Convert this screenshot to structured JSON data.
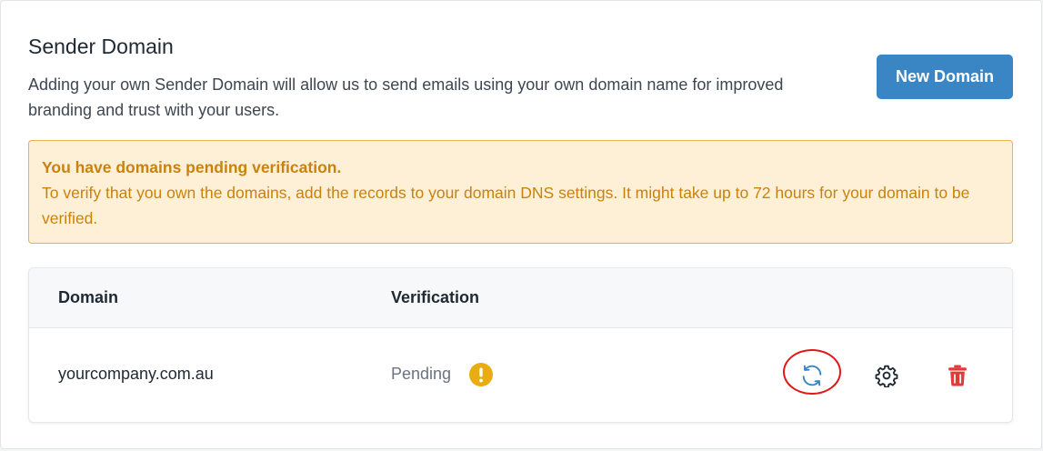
{
  "header": {
    "title": "Sender Domain",
    "description": "Adding your own Sender Domain will allow us to send emails using your own domain name for improved branding and trust with your users.",
    "new_button_label": "New Domain"
  },
  "alert": {
    "title": "You have domains pending verification.",
    "message": "To verify that you own the domains, add the records to your domain DNS settings. It might take up to 72 hours for your domain to be verified."
  },
  "table": {
    "columns": [
      "Domain",
      "Verification"
    ],
    "rows": [
      {
        "domain": "yourcompany.com.au",
        "verification": "Pending",
        "status_icon": "exclamation-circle-icon",
        "actions": [
          "refresh-icon",
          "gear-icon",
          "trash-icon"
        ]
      }
    ]
  },
  "colors": {
    "primary": "#3a86c4",
    "warning_text": "#c9820d",
    "warning_bg": "#fdf0d7",
    "warning_border": "#e8b448",
    "danger": "#e53935",
    "highlight": "#e01818"
  }
}
